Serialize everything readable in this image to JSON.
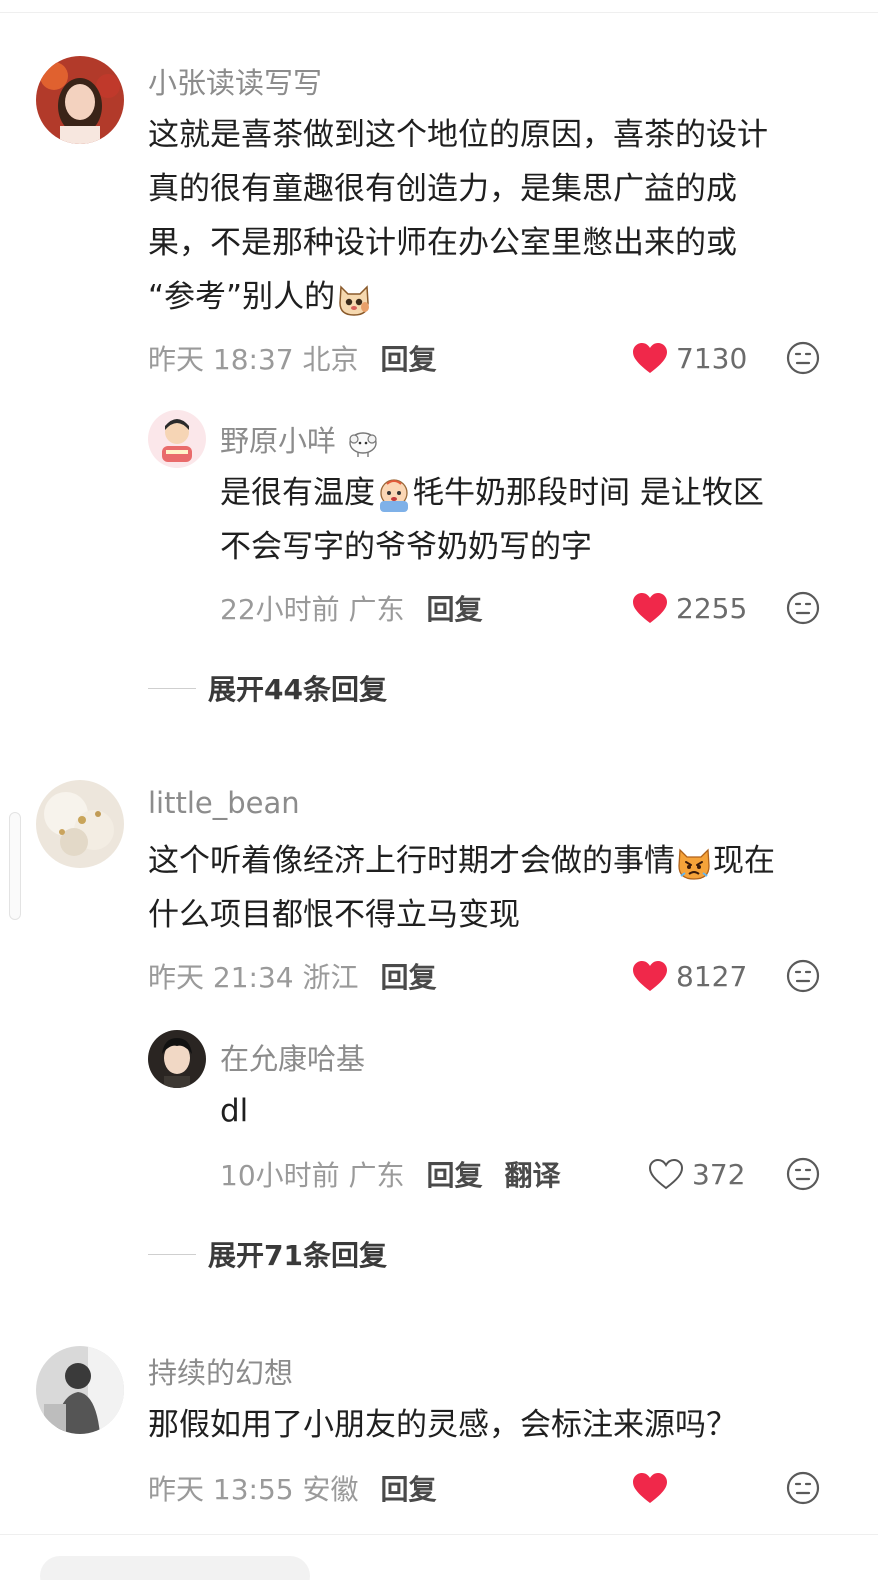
{
  "comments": [
    {
      "username": "小张读读写写",
      "lines": [
        "这就是喜茶做到这个地位的原因，喜茶的设计",
        "真的很有童趣很有创造力，是集思广益的成",
        "果，不是那种设计师在办公室里憋出来的或",
        "“参考”别人的"
      ],
      "time_location": "昨天 18:37 北京",
      "reply_label": "回复",
      "likes": "7130",
      "liked": true,
      "reply": {
        "username": "野原小咩",
        "lines": [
          "是很有温度",
          "牦牛奶那段时间 是让牧区",
          "不会写字的爷爷奶奶写的字"
        ],
        "time_location": "22小时前 广东",
        "reply_label": "回复",
        "likes": "2255",
        "liked": true
      },
      "expand_label": "展开44条回复"
    },
    {
      "username": "little_bean",
      "lines": [
        "这个听着像经济上行时期才会做的事情",
        "现在",
        "什么项目都恨不得立马变现"
      ],
      "time_location": "昨天 21:34 浙江",
      "reply_label": "回复",
      "likes": "8127",
      "liked": true,
      "reply": {
        "username": "在允康哈基",
        "lines": [
          "dl"
        ],
        "time_location": "10小时前 广东",
        "reply_label": "回复",
        "translate_label": "翻译",
        "likes": "372",
        "liked": false
      },
      "expand_label": "展开71条回复"
    },
    {
      "username": "持续的幻想",
      "lines": [
        "那假如用了小朋友的灵感，会标注来源吗？"
      ],
      "time_location": "昨天 13:55 安徽",
      "reply_label": "回复",
      "liked": true
    }
  ],
  "icons": {
    "like_filled": "heart-filled-icon",
    "like_outline": "heart-outline-icon",
    "emoji_reply": "smiley-face-icon"
  },
  "colors": {
    "like_red": "#f0284a",
    "meta_gray": "#9a9a9a",
    "username_gray": "#8c8c8c"
  }
}
